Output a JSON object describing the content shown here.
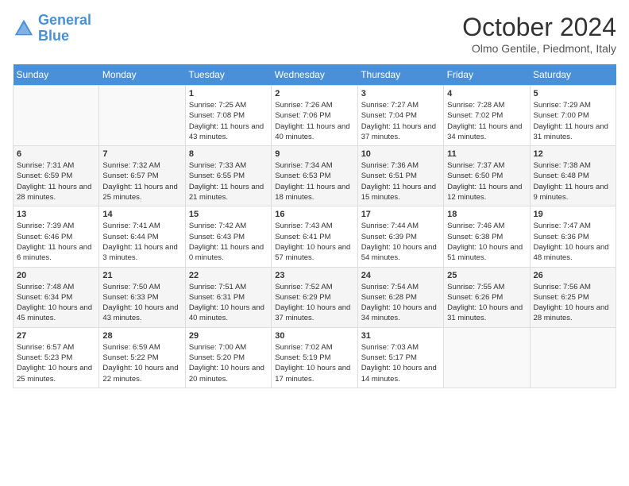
{
  "header": {
    "logo_line1": "General",
    "logo_line2": "Blue",
    "month_title": "October 2024",
    "location": "Olmo Gentile, Piedmont, Italy"
  },
  "weekdays": [
    "Sunday",
    "Monday",
    "Tuesday",
    "Wednesday",
    "Thursday",
    "Friday",
    "Saturday"
  ],
  "weeks": [
    [
      {
        "day": "",
        "sunrise": "",
        "sunset": "",
        "daylight": ""
      },
      {
        "day": "",
        "sunrise": "",
        "sunset": "",
        "daylight": ""
      },
      {
        "day": "1",
        "sunrise": "Sunrise: 7:25 AM",
        "sunset": "Sunset: 7:08 PM",
        "daylight": "Daylight: 11 hours and 43 minutes."
      },
      {
        "day": "2",
        "sunrise": "Sunrise: 7:26 AM",
        "sunset": "Sunset: 7:06 PM",
        "daylight": "Daylight: 11 hours and 40 minutes."
      },
      {
        "day": "3",
        "sunrise": "Sunrise: 7:27 AM",
        "sunset": "Sunset: 7:04 PM",
        "daylight": "Daylight: 11 hours and 37 minutes."
      },
      {
        "day": "4",
        "sunrise": "Sunrise: 7:28 AM",
        "sunset": "Sunset: 7:02 PM",
        "daylight": "Daylight: 11 hours and 34 minutes."
      },
      {
        "day": "5",
        "sunrise": "Sunrise: 7:29 AM",
        "sunset": "Sunset: 7:00 PM",
        "daylight": "Daylight: 11 hours and 31 minutes."
      }
    ],
    [
      {
        "day": "6",
        "sunrise": "Sunrise: 7:31 AM",
        "sunset": "Sunset: 6:59 PM",
        "daylight": "Daylight: 11 hours and 28 minutes."
      },
      {
        "day": "7",
        "sunrise": "Sunrise: 7:32 AM",
        "sunset": "Sunset: 6:57 PM",
        "daylight": "Daylight: 11 hours and 25 minutes."
      },
      {
        "day": "8",
        "sunrise": "Sunrise: 7:33 AM",
        "sunset": "Sunset: 6:55 PM",
        "daylight": "Daylight: 11 hours and 21 minutes."
      },
      {
        "day": "9",
        "sunrise": "Sunrise: 7:34 AM",
        "sunset": "Sunset: 6:53 PM",
        "daylight": "Daylight: 11 hours and 18 minutes."
      },
      {
        "day": "10",
        "sunrise": "Sunrise: 7:36 AM",
        "sunset": "Sunset: 6:51 PM",
        "daylight": "Daylight: 11 hours and 15 minutes."
      },
      {
        "day": "11",
        "sunrise": "Sunrise: 7:37 AM",
        "sunset": "Sunset: 6:50 PM",
        "daylight": "Daylight: 11 hours and 12 minutes."
      },
      {
        "day": "12",
        "sunrise": "Sunrise: 7:38 AM",
        "sunset": "Sunset: 6:48 PM",
        "daylight": "Daylight: 11 hours and 9 minutes."
      }
    ],
    [
      {
        "day": "13",
        "sunrise": "Sunrise: 7:39 AM",
        "sunset": "Sunset: 6:46 PM",
        "daylight": "Daylight: 11 hours and 6 minutes."
      },
      {
        "day": "14",
        "sunrise": "Sunrise: 7:41 AM",
        "sunset": "Sunset: 6:44 PM",
        "daylight": "Daylight: 11 hours and 3 minutes."
      },
      {
        "day": "15",
        "sunrise": "Sunrise: 7:42 AM",
        "sunset": "Sunset: 6:43 PM",
        "daylight": "Daylight: 11 hours and 0 minutes."
      },
      {
        "day": "16",
        "sunrise": "Sunrise: 7:43 AM",
        "sunset": "Sunset: 6:41 PM",
        "daylight": "Daylight: 10 hours and 57 minutes."
      },
      {
        "day": "17",
        "sunrise": "Sunrise: 7:44 AM",
        "sunset": "Sunset: 6:39 PM",
        "daylight": "Daylight: 10 hours and 54 minutes."
      },
      {
        "day": "18",
        "sunrise": "Sunrise: 7:46 AM",
        "sunset": "Sunset: 6:38 PM",
        "daylight": "Daylight: 10 hours and 51 minutes."
      },
      {
        "day": "19",
        "sunrise": "Sunrise: 7:47 AM",
        "sunset": "Sunset: 6:36 PM",
        "daylight": "Daylight: 10 hours and 48 minutes."
      }
    ],
    [
      {
        "day": "20",
        "sunrise": "Sunrise: 7:48 AM",
        "sunset": "Sunset: 6:34 PM",
        "daylight": "Daylight: 10 hours and 45 minutes."
      },
      {
        "day": "21",
        "sunrise": "Sunrise: 7:50 AM",
        "sunset": "Sunset: 6:33 PM",
        "daylight": "Daylight: 10 hours and 43 minutes."
      },
      {
        "day": "22",
        "sunrise": "Sunrise: 7:51 AM",
        "sunset": "Sunset: 6:31 PM",
        "daylight": "Daylight: 10 hours and 40 minutes."
      },
      {
        "day": "23",
        "sunrise": "Sunrise: 7:52 AM",
        "sunset": "Sunset: 6:29 PM",
        "daylight": "Daylight: 10 hours and 37 minutes."
      },
      {
        "day": "24",
        "sunrise": "Sunrise: 7:54 AM",
        "sunset": "Sunset: 6:28 PM",
        "daylight": "Daylight: 10 hours and 34 minutes."
      },
      {
        "day": "25",
        "sunrise": "Sunrise: 7:55 AM",
        "sunset": "Sunset: 6:26 PM",
        "daylight": "Daylight: 10 hours and 31 minutes."
      },
      {
        "day": "26",
        "sunrise": "Sunrise: 7:56 AM",
        "sunset": "Sunset: 6:25 PM",
        "daylight": "Daylight: 10 hours and 28 minutes."
      }
    ],
    [
      {
        "day": "27",
        "sunrise": "Sunrise: 6:57 AM",
        "sunset": "Sunset: 5:23 PM",
        "daylight": "Daylight: 10 hours and 25 minutes."
      },
      {
        "day": "28",
        "sunrise": "Sunrise: 6:59 AM",
        "sunset": "Sunset: 5:22 PM",
        "daylight": "Daylight: 10 hours and 22 minutes."
      },
      {
        "day": "29",
        "sunrise": "Sunrise: 7:00 AM",
        "sunset": "Sunset: 5:20 PM",
        "daylight": "Daylight: 10 hours and 20 minutes."
      },
      {
        "day": "30",
        "sunrise": "Sunrise: 7:02 AM",
        "sunset": "Sunset: 5:19 PM",
        "daylight": "Daylight: 10 hours and 17 minutes."
      },
      {
        "day": "31",
        "sunrise": "Sunrise: 7:03 AM",
        "sunset": "Sunset: 5:17 PM",
        "daylight": "Daylight: 10 hours and 14 minutes."
      },
      {
        "day": "",
        "sunrise": "",
        "sunset": "",
        "daylight": ""
      },
      {
        "day": "",
        "sunrise": "",
        "sunset": "",
        "daylight": ""
      }
    ]
  ]
}
